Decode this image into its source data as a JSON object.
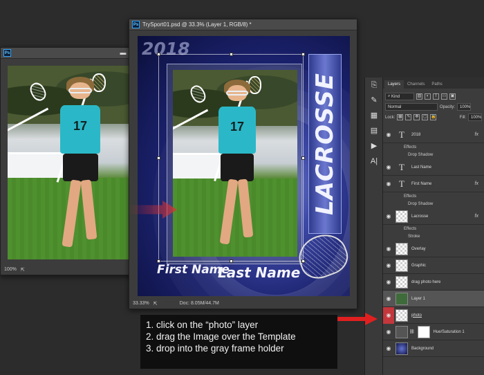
{
  "photo_window": {
    "zoom": "100%"
  },
  "template_window": {
    "title": "TrySport01.psd @ 33.3% (Layer 1, RGB/8) *",
    "zoom": "33.33%",
    "doc_info": "Doc: 8.05M/44.7M",
    "template": {
      "year": "2018",
      "sport": "LACROSSE",
      "first_name": "First Name",
      "last_name": "Last Name"
    }
  },
  "player": {
    "jersey_number": "17"
  },
  "layers_panel": {
    "tabs": [
      "Layers",
      "Channels",
      "Paths"
    ],
    "kind_filter": "Kind",
    "blend_mode": "Normal",
    "opacity_label": "Opacity:",
    "opacity_value": "100%",
    "lock_label": "Lock:",
    "fill_label": "Fill:",
    "fill_value": "100%",
    "layers": {
      "l2018": "2018",
      "l2018_effects": "Effects",
      "l2018_drop": "Drop Shadow",
      "last_name": "Last Name",
      "first_name": "First Name",
      "first_effects": "Effects",
      "first_drop": "Drop Shadow",
      "lacrosse": "Lacrosse",
      "lac_effects": "Effects",
      "lac_stroke": "Stroke",
      "overlay": "Overlay",
      "graphic": "Graphic",
      "drag_photo": "drag photo here",
      "layer1": "Layer 1",
      "photo": "photo",
      "hue_sat": "Hue/Saturation 1",
      "background": "Background"
    },
    "fx_label": "fx"
  },
  "instructions": {
    "step1": "1. click on the “photo” layer",
    "step2": "2. drag the Image over the Template",
    "step3": "3. drop into the gray frame holder"
  },
  "icons": {
    "ps": "Ps",
    "minimize": "▬",
    "maximize": "□",
    "close": "✕",
    "eye": "◉",
    "type": "T",
    "chain": "⛓"
  },
  "colors": {
    "accent_red": "#c4373c",
    "app_bg": "#2c2c2c"
  }
}
